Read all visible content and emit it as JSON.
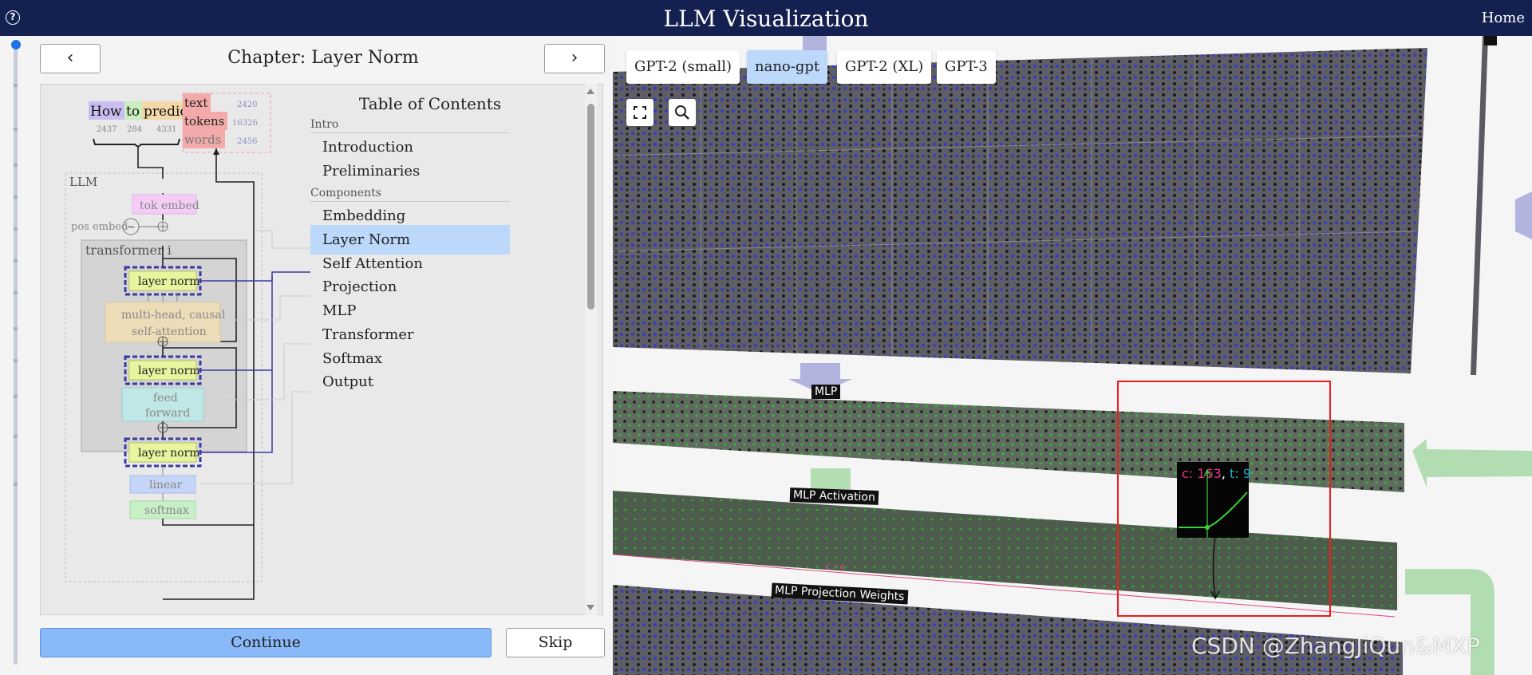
{
  "app": {
    "title": "LLM Visualization",
    "home": "Home",
    "help": "?"
  },
  "chapter": {
    "title": "Chapter: Layer Norm",
    "prev": "‹",
    "next": "›"
  },
  "diagram": {
    "tokens": [
      {
        "text": "How",
        "id": "2437"
      },
      {
        "text": "to",
        "id": "284"
      },
      {
        "text": "predict",
        "id": "4331"
      }
    ],
    "legend": [
      {
        "text": "text",
        "num": "2420"
      },
      {
        "text": "tokens",
        "num": "16326"
      },
      {
        "text": "words",
        "num": "2456"
      }
    ],
    "llm_label": "LLM",
    "tok_embed": "tok embed",
    "pos_embed": "pos embed",
    "transformer_label": "transformer i",
    "layer_norm": "layer norm",
    "attention_1": "multi-head, causal",
    "attention_2": "self-attention",
    "ff_1": "feed",
    "ff_2": "forward",
    "linear": "linear",
    "softmax": "softmax",
    "tilde": "~"
  },
  "toc": {
    "title": "Table of Contents",
    "sections": [
      {
        "label": "Intro",
        "items": [
          "Introduction",
          "Preliminaries"
        ]
      },
      {
        "label": "Components",
        "items": [
          "Embedding",
          "Layer Norm",
          "Self Attention",
          "Projection",
          "MLP",
          "Transformer",
          "Softmax",
          "Output"
        ]
      }
    ],
    "active": "Layer Norm"
  },
  "actions": {
    "continue": "Continue",
    "skip": "Skip"
  },
  "models": [
    "GPT-2 (small)",
    "nano-gpt",
    "GPT-2 (XL)",
    "GPT-3"
  ],
  "active_model": "nano-gpt",
  "viz_labels": {
    "mlp": "MLP",
    "mlp_activation": "MLP Activation",
    "mlp_projection": "MLP Projection Weights",
    "c4": "C * 4"
  },
  "tooltip": {
    "c_label": "c: 163",
    "t_label": "t: 9",
    "sep": ", "
  },
  "watermark": "CSDN @ZhangJiQun&MXP",
  "colors": {
    "topbar": "#142150",
    "active": "#bcd8fb",
    "continue": "#89b9f8",
    "highlight_box": "#ee1c1c"
  }
}
